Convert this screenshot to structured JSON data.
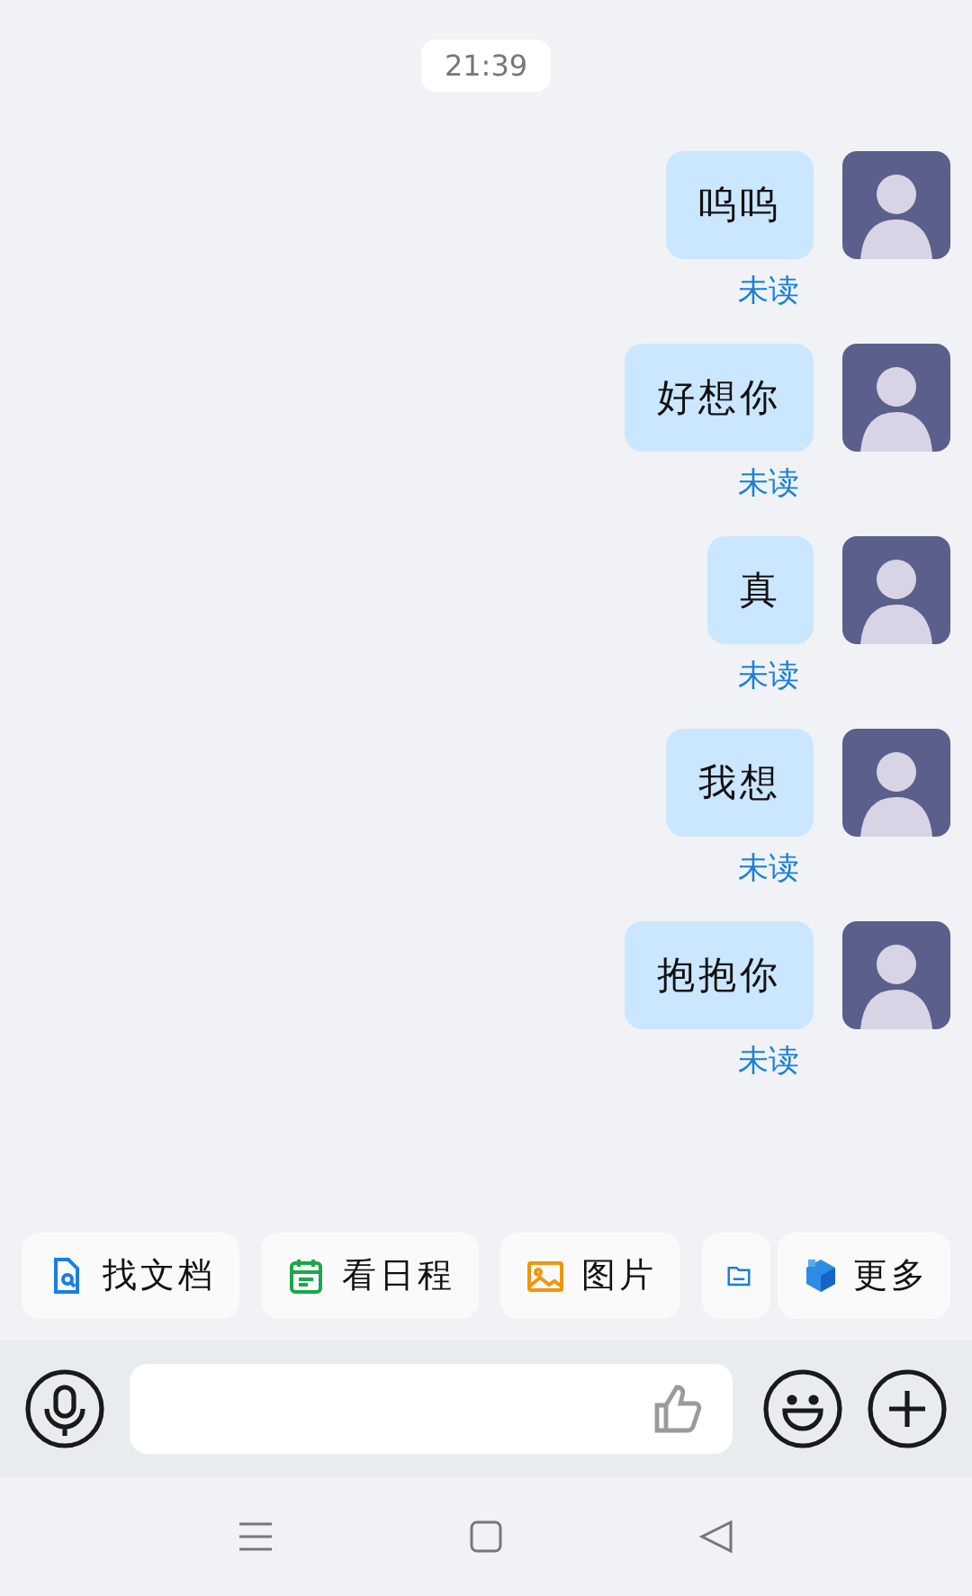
{
  "time": "21:39",
  "messages": [
    {
      "text": "呜呜",
      "status": "未读"
    },
    {
      "text": "好想你",
      "status": "未读"
    },
    {
      "text": "真",
      "status": "未读"
    },
    {
      "text": "我想",
      "status": "未读"
    },
    {
      "text": "抱抱你",
      "status": "未读"
    }
  ],
  "quick_actions": [
    {
      "kind": "doc",
      "label": "找文档"
    },
    {
      "kind": "calendar",
      "label": "看日程"
    },
    {
      "kind": "image",
      "label": "图片"
    },
    {
      "kind": "folder"
    }
  ],
  "more_action": {
    "label": "更多"
  }
}
